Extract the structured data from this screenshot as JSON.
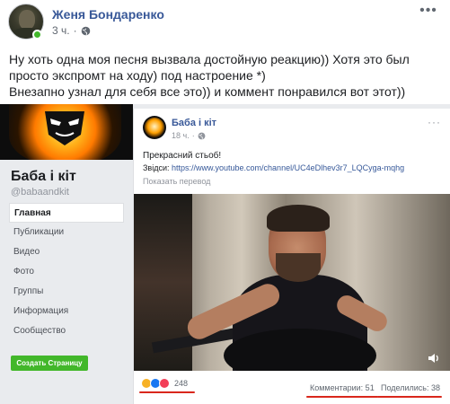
{
  "post": {
    "author": "Женя Бондаренко",
    "time": "3 ч.",
    "lines": [
      "Ну хоть одна моя песня вызвала достойную реакцию)) Хотя это был",
      "просто экспромт на ходу) под настроение *)",
      "Внезапно узнал для себя все это)) и коммент понравился вот этот))"
    ]
  },
  "page": {
    "name": "Баба і кіт",
    "handle": "@babaandkit",
    "nav": [
      "Главная",
      "Публикации",
      "Видео",
      "Фото",
      "Группы",
      "Информация",
      "Сообщество"
    ],
    "create_button": "Создать Страницу"
  },
  "embedded_post": {
    "author": "Баба і кіт",
    "time": "18 ч.",
    "text": "Прекрасний стьоб!",
    "link_prefix": "Звідси: ",
    "link": "https://www.youtube.com/channel/UC4eDlhev3r7_LQCyga-mqhg",
    "translate": "Показать перевод",
    "reactions_count": "248",
    "comments": "Комментарии: 51",
    "shares": "Поделились: 38"
  },
  "icons": [
    "globe-icon",
    "more-icon",
    "volume-icon",
    "haha-reaction-icon",
    "like-reaction-icon",
    "love-reaction-icon"
  ],
  "colors": {
    "link": "#385898",
    "online": "#42b72a",
    "highlight": "#d9271c"
  }
}
